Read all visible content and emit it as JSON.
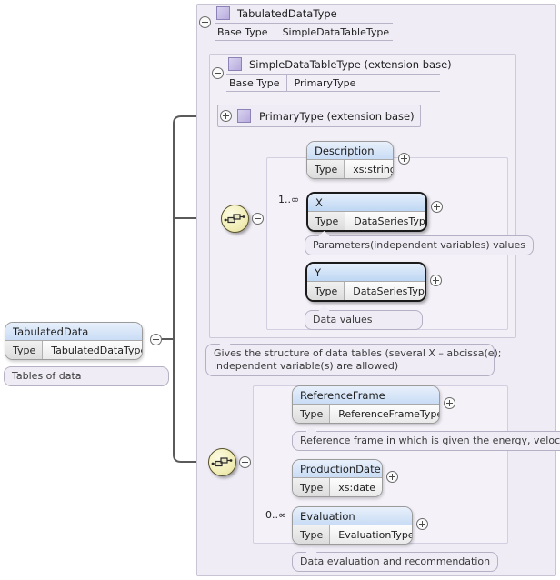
{
  "diagram": {
    "kind": "xml-schema-diagram",
    "colors": {
      "panel_bg": "#efecf5",
      "node_header": "#c9ddf5",
      "compositor": "#f3efb9",
      "border": "#b9b3c7"
    }
  },
  "root_type": {
    "title": "TabulatedDataType",
    "base_type_label": "Base Type",
    "base_type_value": "SimpleDataTableType",
    "toggle": "minus"
  },
  "extension_type": {
    "title": "SimpleDataTableType (extension base)",
    "base_type_label": "Base Type",
    "base_type_value": "PrimaryType",
    "toggle": "minus"
  },
  "primary_type": {
    "title": "PrimaryType (extension base)",
    "toggle": "plus"
  },
  "root_element": {
    "name": "TabulatedData",
    "type_label": "Type",
    "type_value": "TabulatedDataType",
    "annotation": "Tables of data",
    "toggle": "minus"
  },
  "sequences": [
    {
      "id": "sequence-upper",
      "icon": "sequence-icon",
      "toggle": "minus",
      "annotation": "Gives the structure of data tables (several X – abcissa(e);\nindependent variable(s) are allowed)"
    },
    {
      "id": "sequence-lower",
      "icon": "sequence-icon",
      "toggle": "minus"
    }
  ],
  "upper_elements": [
    {
      "name": "Description",
      "type_label": "Type",
      "type_value": "xs:string",
      "cardinality": "",
      "required": false,
      "toggle": "plus",
      "annotation": ""
    },
    {
      "name": "X",
      "type_label": "Type",
      "type_value": "DataSeriesType",
      "cardinality": "1..∞",
      "required": true,
      "toggle": "plus",
      "annotation": "Parameters(independent variables) values"
    },
    {
      "name": "Y",
      "type_label": "Type",
      "type_value": "DataSeriesType",
      "cardinality": "",
      "required": true,
      "toggle": "plus",
      "annotation": "Data values"
    }
  ],
  "lower_elements": [
    {
      "name": "ReferenceFrame",
      "type_label": "Type",
      "type_value": "ReferenceFrameType",
      "cardinality": "",
      "required": false,
      "toggle": "plus",
      "annotation": "Reference frame in which is given the energy, velocity..."
    },
    {
      "name": "ProductionDate",
      "type_label": "Type",
      "type_value": "xs:date",
      "cardinality": "",
      "required": false,
      "toggle": "plus",
      "annotation": ""
    },
    {
      "name": "Evaluation",
      "type_label": "Type",
      "type_value": "EvaluationType",
      "cardinality": "0..∞",
      "required": false,
      "toggle": "plus",
      "annotation": "Data evaluation and recommendation"
    }
  ]
}
